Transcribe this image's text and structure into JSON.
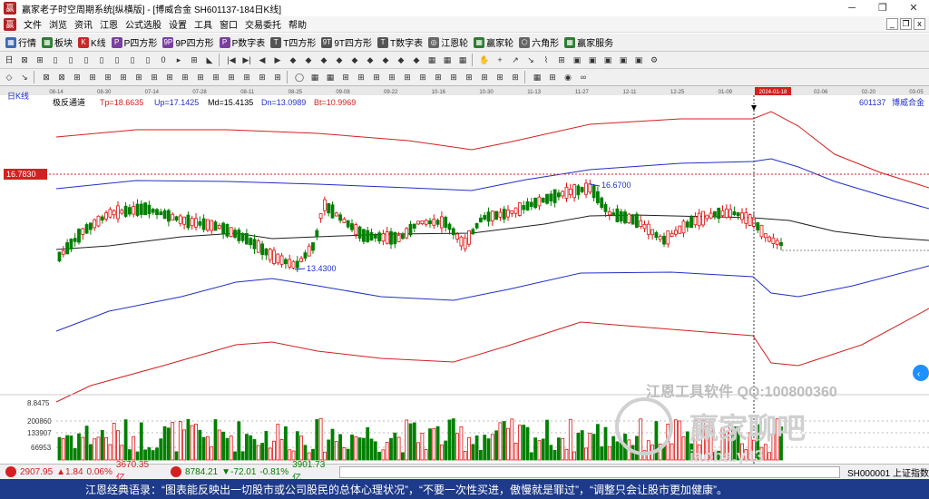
{
  "window": {
    "title": "赢家老子时空周期系统[纵横版] - [博威合金  SH601137-184日K线]",
    "logo_char": "赢",
    "minimize": "─",
    "maximize": "❐",
    "close": "✕"
  },
  "menu": {
    "logo_char": "赢",
    "items": [
      "文件",
      "浏览",
      "资讯",
      "江恩",
      "公式选股",
      "设置",
      "工具",
      "窗口",
      "交易委托",
      "帮助"
    ]
  },
  "mdi_controls": [
    "_",
    "❐",
    "x"
  ],
  "toolbar1": [
    {
      "label": "行情",
      "icon": "grid-icon",
      "glyph": "▦",
      "color": "#3b6bb5"
    },
    {
      "label": "板块",
      "icon": "blocks-icon",
      "glyph": "▦",
      "color": "#2e7d32"
    },
    {
      "label": "K线",
      "icon": "kline-icon",
      "glyph": "K",
      "color": "#c62828"
    },
    {
      "label": "P四方形",
      "icon": "p-square-icon",
      "glyph": "P",
      "color": "#7b3fa0"
    },
    {
      "label": "9P四方形",
      "icon": "9p-square-icon",
      "glyph": "9P",
      "color": "#7b3fa0"
    },
    {
      "label": "P数字表",
      "icon": "p-table-icon",
      "glyph": "P",
      "color": "#7b3fa0"
    },
    {
      "label": "T四方形",
      "icon": "t-square-icon",
      "glyph": "T",
      "color": "#555"
    },
    {
      "label": "9T四方形",
      "icon": "9t-square-icon",
      "glyph": "9T",
      "color": "#555"
    },
    {
      "label": "T数字表",
      "icon": "t-table-icon",
      "glyph": "T",
      "color": "#555"
    },
    {
      "label": "江恩轮",
      "icon": "gann-wheel-icon",
      "glyph": "◎",
      "color": "#666"
    },
    {
      "label": "赢家轮",
      "icon": "winner-wheel-icon",
      "glyph": "▦",
      "color": "#2e7d32"
    },
    {
      "label": "六角形",
      "icon": "hexagon-icon",
      "glyph": "⬡",
      "color": "#666"
    },
    {
      "label": "赢家服务",
      "icon": "service-icon",
      "glyph": "▦",
      "color": "#2e7d32"
    }
  ],
  "toolbar2_icons": [
    "日",
    "⊠",
    "⊞",
    "▯",
    "▯",
    "▯",
    "▯",
    "▯",
    "▯",
    "▯",
    "0",
    "▸",
    "⊞",
    "◣",
    "|◀",
    "▶|",
    "◀",
    "▶",
    "◆",
    "◆",
    "◆",
    "◆",
    "◆",
    "◆",
    "◆",
    "◆",
    "◆",
    "▦",
    "▦",
    "▦",
    "✋",
    "+",
    "↗",
    "↘",
    "⌇",
    "⊞",
    "▣",
    "▣",
    "▣",
    "▣",
    "▣",
    "⚙"
  ],
  "toolbar3_icons": [
    "◇",
    "↘",
    "⊠",
    "⊠",
    "⊞",
    "⊞",
    "⊞",
    "⊞",
    "⊞",
    "⊞",
    "⊞",
    "⊞",
    "⊞",
    "⊞",
    "⊞",
    "⊞",
    "⊞",
    "⊞",
    "◯",
    "▦",
    "▦",
    "⊞",
    "⊞",
    "⊞",
    "⊞",
    "⊞",
    "⊞",
    "⊞",
    "⊞",
    "⊞",
    "⊞",
    "⊞",
    "⊞",
    "▦",
    "⊞",
    "◉",
    "∞"
  ],
  "chart": {
    "period_label": "日K线",
    "date_axis": [
      "08-14",
      "08-30",
      "07-14",
      "07-28",
      "08-11",
      "08-25",
      "09-08",
      "09-22",
      "10-16",
      "10-30",
      "11-13",
      "11-27",
      "12-11",
      "12-25",
      "01-09",
      "2024-01-18",
      "02-06",
      "02-20",
      "03-05"
    ],
    "indicator_name": "极反通道",
    "tp": "Tp=18.6635",
    "up": "Up=17.1425",
    "md": "Md=15.4135",
    "dn": "Dn=13.0989",
    "bt": "Bt=10.9969",
    "stock_code": "601137",
    "stock_name": "博威合金",
    "price_label": "16.7830",
    "high_annotation": "16.6700",
    "low_annotation": "13.4300",
    "volume_scale": [
      "8.8475",
      "200860",
      "133907",
      "66953"
    ],
    "watermark_1": "江恩工具软件  QQ:100800360",
    "watermark_2": "赢家聊吧",
    "watermark_3": "iaoba.y.t3"
  },
  "status": {
    "index1_value": "2907.95",
    "index1_change": "▲1.84",
    "index1_pct": "0.06%",
    "index1_amount": "3670.35亿",
    "index2_value": "8784.21",
    "index2_change": "▼-72.01",
    "index2_pct": "-0.81%",
    "index2_amount": "3901.73亿",
    "right_index": "SH000001 上证指数"
  },
  "quote": "江恩经典语录：“图表能反映出一切股市或公司股民的总体心理状况”，“不要一次性买进，傲慢就是罪过”，“调整只会让股市更加健康”。",
  "colors": {
    "up": "#e01010",
    "down": "#008000",
    "band_outer": "#d42020",
    "band_inner": "#2030c8",
    "mid": "#202020"
  }
}
